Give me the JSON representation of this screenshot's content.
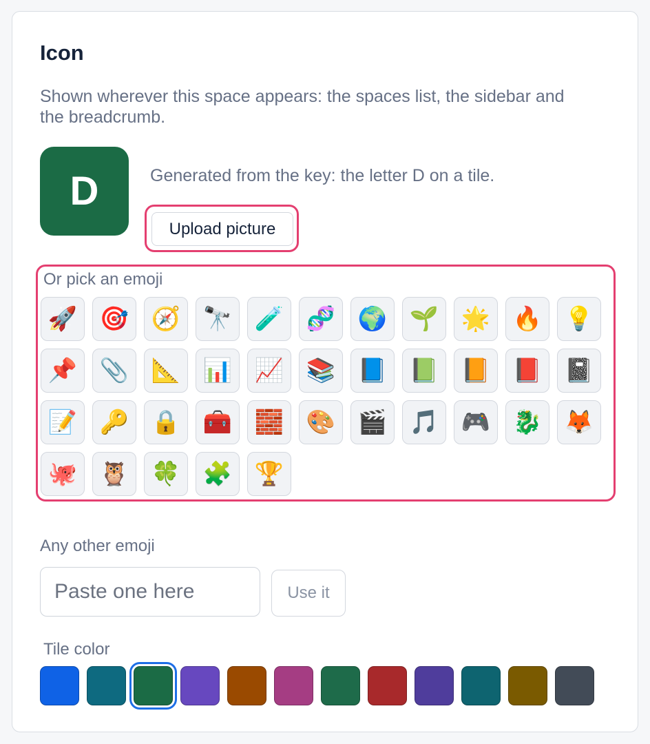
{
  "section": {
    "title": "Icon",
    "description": "Shown wherever this space appears: the spaces list, the sidebar and the breadcrumb."
  },
  "tile": {
    "letter": "D",
    "color": "#1b6b45",
    "note": "Generated from the key: the letter D on a tile."
  },
  "upload": {
    "label": "Upload picture"
  },
  "emoji_picker": {
    "label": "Or pick an emoji",
    "emojis": [
      "🚀",
      "🎯",
      "🧭",
      "🔭",
      "🧪",
      "🧬",
      "🌍",
      "🌱",
      "🌟",
      "🔥",
      "💡",
      "📌",
      "📎",
      "📐",
      "📊",
      "📈",
      "📚",
      "📘",
      "📗",
      "📙",
      "📕",
      "📓",
      "📝",
      "🔑",
      "🔒",
      "🧰",
      "🧱",
      "🎨",
      "🎬",
      "🎵",
      "🎮",
      "🐉",
      "🦊",
      "🐙",
      "🦉",
      "🍀",
      "🧩",
      "🏆"
    ]
  },
  "other_emoji": {
    "label": "Any other emoji",
    "placeholder": "Paste one here",
    "value": "",
    "button": "Use it"
  },
  "tile_color": {
    "label": "Tile color",
    "selected_index": 2,
    "colors": [
      "#0f62e6",
      "#0e6a80",
      "#1b6b45",
      "#6748bf",
      "#9a4a00",
      "#a53d83",
      "#1e6b4a",
      "#a8292b",
      "#4f3d9c",
      "#0e6470",
      "#7a5a00",
      "#424b57"
    ]
  }
}
